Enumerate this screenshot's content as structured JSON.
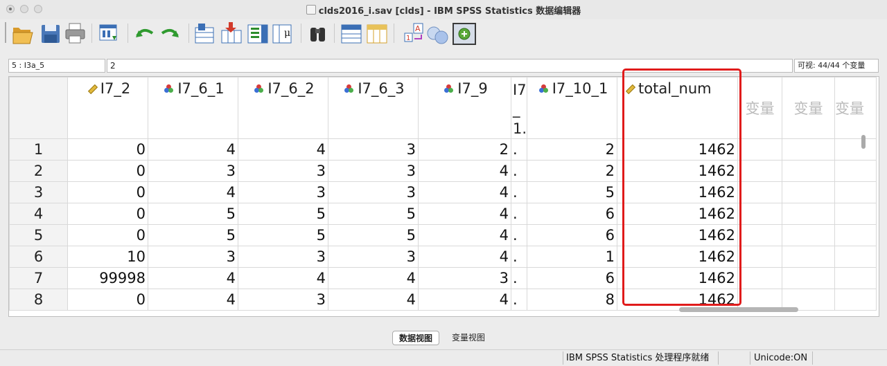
{
  "window": {
    "title": "clds2016_i.sav [clds] - IBM SPSS Statistics 数据编辑器"
  },
  "toolbar": {
    "buttons": [
      {
        "name": "open-icon"
      },
      {
        "name": "save-icon"
      },
      {
        "name": "print-icon"
      },
      {
        "name": "recall-dialog-icon"
      },
      {
        "name": "undo-icon"
      },
      {
        "name": "redo-icon"
      },
      {
        "name": "goto-case-icon"
      },
      {
        "name": "goto-variable-icon"
      },
      {
        "name": "variables-icon"
      },
      {
        "name": "run-descriptives-icon"
      },
      {
        "name": "find-icon"
      },
      {
        "name": "insert-cases-icon"
      },
      {
        "name": "insert-variable-icon"
      },
      {
        "name": "split-file-icon"
      },
      {
        "name": "weight-cases-icon"
      },
      {
        "name": "select-cases-icon"
      },
      {
        "name": "value-labels-icon"
      }
    ]
  },
  "cell_editor": {
    "reference": "5 : I3a_5",
    "value": "2",
    "visible": "可视: 44/44 个变量"
  },
  "grid": {
    "columns": [
      {
        "label": "I7_2",
        "type": "scale"
      },
      {
        "label": "I7_6_1",
        "type": "nominal"
      },
      {
        "label": "I7_6_2",
        "type": "nominal"
      },
      {
        "label": "I7_6_3",
        "type": "nominal"
      },
      {
        "label": "I7_9",
        "type": "nominal"
      },
      {
        "label": "I7_1.",
        "type": "truncated"
      },
      {
        "label": "I7_10_1",
        "type": "nominal"
      },
      {
        "label": "total_num",
        "type": "scale"
      }
    ],
    "empty_column_label": "变量",
    "rows": [
      {
        "n": "1",
        "cells": [
          "0",
          "4",
          "4",
          "3",
          "2",
          ".",
          "2",
          "1462"
        ]
      },
      {
        "n": "2",
        "cells": [
          "0",
          "3",
          "3",
          "3",
          "4",
          ".",
          "2",
          "1462"
        ]
      },
      {
        "n": "3",
        "cells": [
          "0",
          "4",
          "3",
          "3",
          "4",
          ".",
          "5",
          "1462"
        ]
      },
      {
        "n": "4",
        "cells": [
          "0",
          "5",
          "5",
          "5",
          "4",
          ".",
          "6",
          "1462"
        ]
      },
      {
        "n": "5",
        "cells": [
          "0",
          "5",
          "5",
          "5",
          "4",
          ".",
          "6",
          "1462"
        ]
      },
      {
        "n": "6",
        "cells": [
          "10",
          "3",
          "3",
          "3",
          "4",
          ".",
          "1",
          "1462"
        ]
      },
      {
        "n": "7",
        "cells": [
          "99998",
          "4",
          "4",
          "4",
          "3",
          ".",
          "6",
          "1462"
        ]
      },
      {
        "n": "8",
        "cells": [
          "0",
          "4",
          "3",
          "4",
          "4",
          ".",
          "8",
          "1462"
        ]
      }
    ],
    "highlight_color": "#e01b1b"
  },
  "tabs": {
    "data_view": "数据视图",
    "variable_view": "变量视图"
  },
  "status": {
    "processor": "IBM SPSS Statistics 处理程序就绪",
    "unicode": "Unicode:ON"
  }
}
